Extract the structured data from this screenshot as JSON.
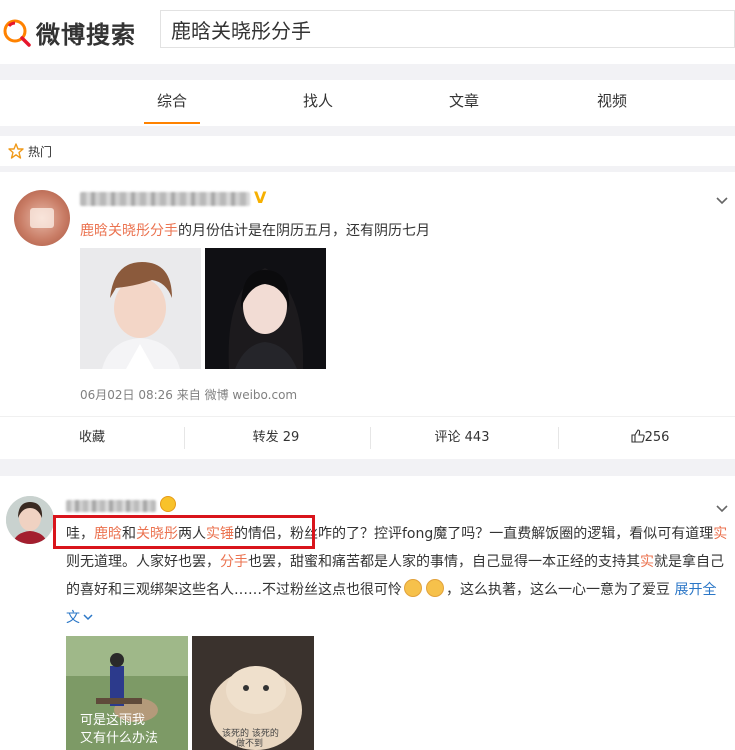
{
  "header": {
    "logo_text": "微博搜索",
    "search_value": "鹿晗关晓彤分手",
    "colors": {
      "logo_accent": "#e6162d",
      "logo_orange": "#ff8200"
    }
  },
  "tabs": [
    {
      "label": "综合",
      "active": true
    },
    {
      "label": "找人",
      "active": false
    },
    {
      "label": "文章",
      "active": false
    },
    {
      "label": "视频",
      "active": false
    }
  ],
  "hot": {
    "label": "热门",
    "icon": "star-icon"
  },
  "post1": {
    "verified_badge": "V",
    "text_highlight": "鹿晗关晓彤分手",
    "text_rest": "的月份估计是在阴历五月，还有阴历七月",
    "meta": "06月02日 08:26  来自 微博 weibo.com",
    "actions": {
      "favorite": "收藏",
      "repost": "转发 29",
      "comment": "评论 443",
      "like": "256"
    }
  },
  "post2": {
    "segments": [
      {
        "text": "哇，",
        "type": "normal"
      },
      {
        "text": "鹿晗",
        "type": "highlight"
      },
      {
        "text": "和",
        "type": "normal"
      },
      {
        "text": "关晓彤",
        "type": "highlight"
      },
      {
        "text": "两人",
        "type": "normal"
      },
      {
        "text": "实锤",
        "type": "highlight"
      },
      {
        "text": "的情侣，粉丝咋的了？控评fong魔了吗？一直费解饭圈的逻辑，看似可有道理",
        "type": "normal"
      },
      {
        "text": "实",
        "type": "highlight"
      },
      {
        "text": "则无道理。人家好也罢，",
        "type": "normal"
      },
      {
        "text": "分手",
        "type": "highlight"
      },
      {
        "text": "也罢，甜蜜和痛苦都是人家的事情，自己显得一本正经的支持其",
        "type": "normal"
      },
      {
        "text": "实",
        "type": "highlight"
      },
      {
        "text": "就是拿自己的喜好和三观绑架这些名人……不过粉丝这点也很可怜",
        "type": "normal"
      },
      {
        "text": "",
        "type": "emoji"
      },
      {
        "text": "",
        "type": "emoji"
      },
      {
        "text": "，这么执著，这么一心一意为了爱豆 ",
        "type": "normal"
      },
      {
        "text": "展开全文",
        "type": "link"
      }
    ],
    "image1_caption": "可是这雨我\n又有什么办法",
    "image2_caption": "该死的 该死的\n做不到"
  }
}
